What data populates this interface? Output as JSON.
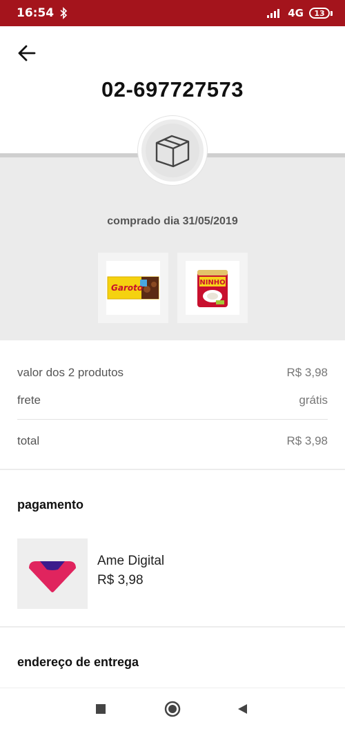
{
  "status_bar": {
    "time": "16:54",
    "network": "4G",
    "battery": "13"
  },
  "order": {
    "number": "02-697727573",
    "purchase_date": "comprado dia 31/05/2019"
  },
  "products": [
    {
      "name": "Garoto",
      "icon": "chocolate-bar-image"
    },
    {
      "name": "NINHO",
      "icon": "milk-can-image"
    }
  ],
  "summary": {
    "products_label": "valor dos 2 produtos",
    "products_value": "R$ 3,98",
    "shipping_label": "frete",
    "shipping_value": "grátis",
    "total_label": "total",
    "total_value": "R$ 3,98"
  },
  "payment": {
    "title": "pagamento",
    "method": "Ame Digital",
    "amount": "R$ 3,98"
  },
  "delivery": {
    "title": "endereço de entrega"
  },
  "colors": {
    "status_bar": "#a4141c",
    "ame_logo": "#e0245e",
    "ame_logo_top": "#3b1b8c"
  }
}
